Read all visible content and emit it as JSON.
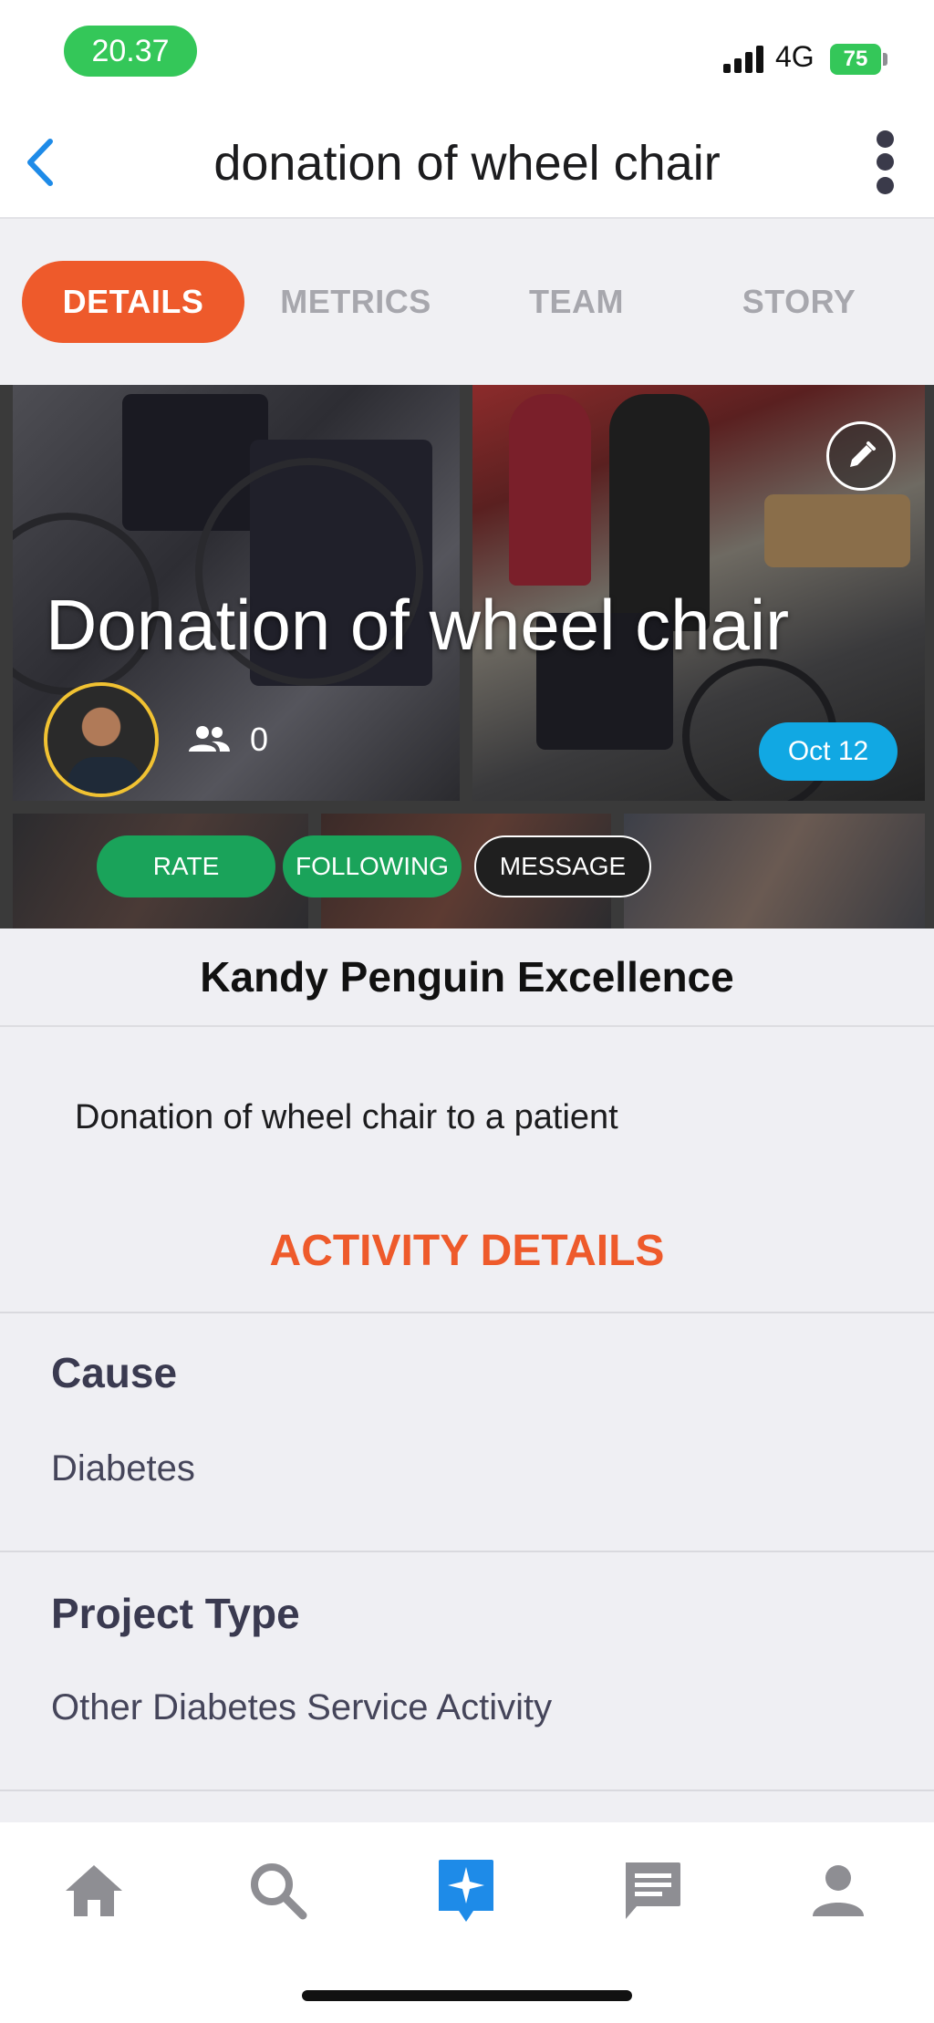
{
  "status_bar": {
    "time": "20.37",
    "network": "4G",
    "battery": "75"
  },
  "header": {
    "title": "donation of wheel chair"
  },
  "tabs": [
    {
      "label": "DETAILS",
      "active": true
    },
    {
      "label": "METRICS",
      "active": false
    },
    {
      "label": "TEAM",
      "active": false
    },
    {
      "label": "STORY",
      "active": false
    }
  ],
  "hero": {
    "title": "Donation of wheel chair",
    "member_count": "0",
    "date": "Oct 12",
    "actions": {
      "rate": "RATE",
      "following": "FOLLOWING",
      "message": "MESSAGE"
    }
  },
  "organization": {
    "name": "Kandy Penguin Excellence"
  },
  "description": "Donation of wheel chair to a patient",
  "activity_details": {
    "title": "ACTIVITY DETAILS",
    "fields": [
      {
        "label": "Cause",
        "value": "Diabetes"
      },
      {
        "label": "Project Type",
        "value": "Other Diabetes Service Activity"
      }
    ]
  },
  "bottom_nav": {
    "items": [
      "home-icon",
      "search-icon",
      "activity-icon",
      "chat-icon",
      "profile-icon"
    ],
    "active_color": "#1e8be8",
    "inactive_color": "#8e8e93"
  },
  "colors": {
    "accent": "#ee5a2b",
    "green": "#1aa35a",
    "date_badge": "#11a8e3"
  }
}
